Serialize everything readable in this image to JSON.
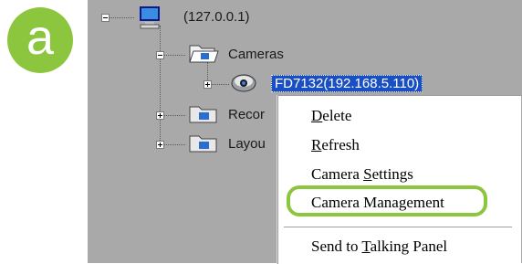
{
  "badge": {
    "letter": "a",
    "color": "#8cc63f"
  },
  "tree": {
    "root": {
      "label": "(127.0.0.1)",
      "icon": "computer-icon"
    },
    "cameras": {
      "label": "Cameras",
      "icon": "open-folder-icon"
    },
    "camera_item": {
      "label": "FD7132(192.168.5.110)",
      "icon": "camera-icon"
    },
    "recordings": {
      "label": "Recor",
      "icon": "folder-camera-icon"
    },
    "layouts": {
      "label": "Layou",
      "icon": "folder-camera-icon"
    }
  },
  "context_menu": {
    "items": [
      {
        "prefix": "",
        "key": "D",
        "rest": "elete"
      },
      {
        "prefix": "",
        "key": "R",
        "rest": "efresh"
      },
      {
        "prefix": "Camera ",
        "key": "S",
        "rest": "ettings"
      },
      {
        "prefix": "Camera Management",
        "key": "",
        "rest": ""
      },
      {
        "prefix": "Send to ",
        "key": "T",
        "rest": "alking Panel"
      }
    ],
    "highlight_color": "#8cc63f",
    "selection_color": "#1a4fc4"
  }
}
